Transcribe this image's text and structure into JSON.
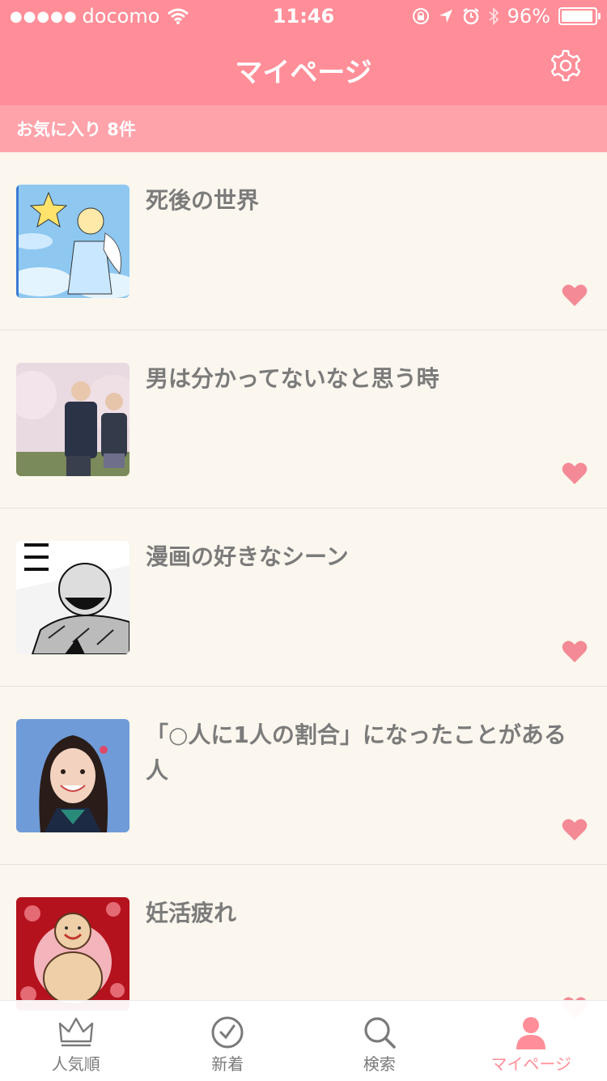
{
  "status_bar": {
    "signal_dots": "●●●●●",
    "carrier": "docomo",
    "time": "11:46",
    "battery_percent": "96%",
    "battery_level": 0.96
  },
  "nav": {
    "title": "マイページ",
    "settings_icon": "gear-icon"
  },
  "favorites_header": "お気に入り 8件",
  "favorites": [
    {
      "title": "死後の世界",
      "thumb": "angel-illustration",
      "favorited": true
    },
    {
      "title": "男は分かってないなと思う時",
      "thumb": "couple-photo",
      "favorited": true
    },
    {
      "title": "漫画の好きなシーン",
      "thumb": "manga-panel",
      "favorited": true
    },
    {
      "title": "「○人に1人の割合」になったことがある人",
      "thumb": "girl-portrait",
      "favorited": true
    },
    {
      "title": "妊活疲れ",
      "thumb": "buddha-illustration",
      "favorited": true
    }
  ],
  "tabs": [
    {
      "label": "人気順",
      "icon": "crown-icon",
      "active": false
    },
    {
      "label": "新着",
      "icon": "clock-icon",
      "active": false
    },
    {
      "label": "検索",
      "icon": "search-icon",
      "active": false
    },
    {
      "label": "マイページ",
      "icon": "person-icon",
      "active": true
    }
  ],
  "colors": {
    "header": "#ff8e98",
    "subheader": "#ffa3ab",
    "background": "#fbf6ee",
    "heart": "#f48a95",
    "title_text": "#7b7b7b"
  }
}
